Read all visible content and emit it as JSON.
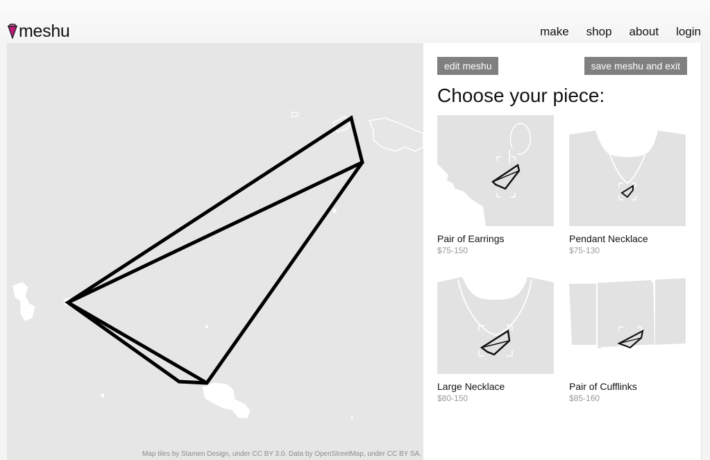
{
  "brand": {
    "name": "meshu",
    "accent": "#c0187a"
  },
  "nav": {
    "make": "make",
    "shop": "shop",
    "about": "about",
    "login": "login"
  },
  "map": {
    "attribution": "Map tiles by Stamen Design, under CC BY 3.0. Data by OpenStreetMap, under CC BY SA."
  },
  "panel": {
    "edit_label": "edit meshu",
    "save_label": "save meshu and exit",
    "heading": "Choose your piece:",
    "pieces": [
      {
        "name": "Pair of Earrings",
        "price": "$75-150"
      },
      {
        "name": "Pendant Necklace",
        "price": "$75-130"
      },
      {
        "name": "Large Necklace",
        "price": "$80-150"
      },
      {
        "name": "Pair of Cufflinks",
        "price": "$85-160"
      }
    ]
  }
}
